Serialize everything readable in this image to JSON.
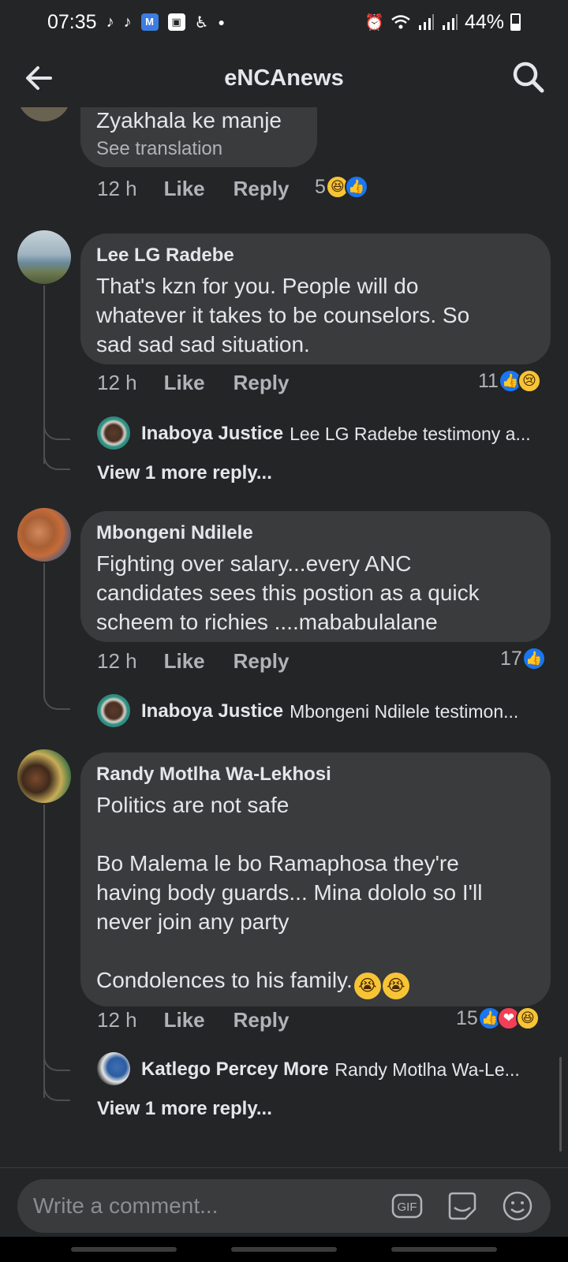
{
  "status_bar": {
    "time": "07:35",
    "left_icons": [
      "tiktok-icon",
      "tiktok-icon",
      "app-icon",
      "gallery-icon",
      "accessibility-icon",
      "dot-icon"
    ],
    "right_icons": [
      "alarm-icon",
      "wifi-icon",
      "signal-icon",
      "signal-icon"
    ],
    "battery": "44%"
  },
  "header": {
    "title": "eNCAnews",
    "back_icon": "arrow-left-icon",
    "search_icon": "search-icon"
  },
  "comments": [
    {
      "author": "",
      "text": "Zyakhala ke manje",
      "see_translation": "See translation",
      "time": "12 h",
      "like": "Like",
      "reply": "Reply",
      "reaction_count": "5",
      "reactions": [
        "haha",
        "like"
      ]
    },
    {
      "author": "Lee LG Radebe",
      "text": "That's kzn for you. People will do\nwhatever it takes to be counselors. So\nsad sad sad situation.",
      "time": "12 h",
      "like": "Like",
      "reply": "Reply",
      "reaction_count": "11",
      "reactions": [
        "like",
        "sad"
      ],
      "replies": [
        {
          "name": "Inaboya Justice",
          "snippet": "Lee LG Radebe testimony a..."
        }
      ],
      "view_more": "View 1 more reply..."
    },
    {
      "author": "Mbongeni Ndilele",
      "text": "Fighting over salary...every ANC\ncandidates sees  this postion as a quick\nscheem to richies ....mababulalane",
      "time": "12 h",
      "like": "Like",
      "reply": "Reply",
      "reaction_count": "17",
      "reactions": [
        "like"
      ],
      "replies": [
        {
          "name": "Inaboya Justice",
          "snippet": "Mbongeni Ndilele testimon..."
        }
      ]
    },
    {
      "author": "Randy Motlha Wa-Lekhosi",
      "text": "Politics are not safe\n\nBo Malema le bo Ramaphosa they're\nhaving body guards... Mina dololo so I'll\nnever join any party\n\nCondolences to his family.",
      "time": "12 h",
      "like": "Like",
      "reply": "Reply",
      "reaction_count": "15",
      "reactions": [
        "like",
        "love",
        "haha"
      ],
      "replies": [
        {
          "name": "Katlego Percey More",
          "snippet": "Randy Motlha Wa-Le..."
        }
      ],
      "view_more": "View 1 more reply..."
    }
  ],
  "composer": {
    "placeholder": "Write a comment...",
    "icons": [
      "gif-icon",
      "sticker-icon",
      "emoji-icon"
    ]
  },
  "colors": {
    "background": "#242526",
    "bubble": "#3a3b3c",
    "like_blue": "#1877f2",
    "love_red": "#f33e58",
    "haha_yellow": "#f7c436"
  }
}
